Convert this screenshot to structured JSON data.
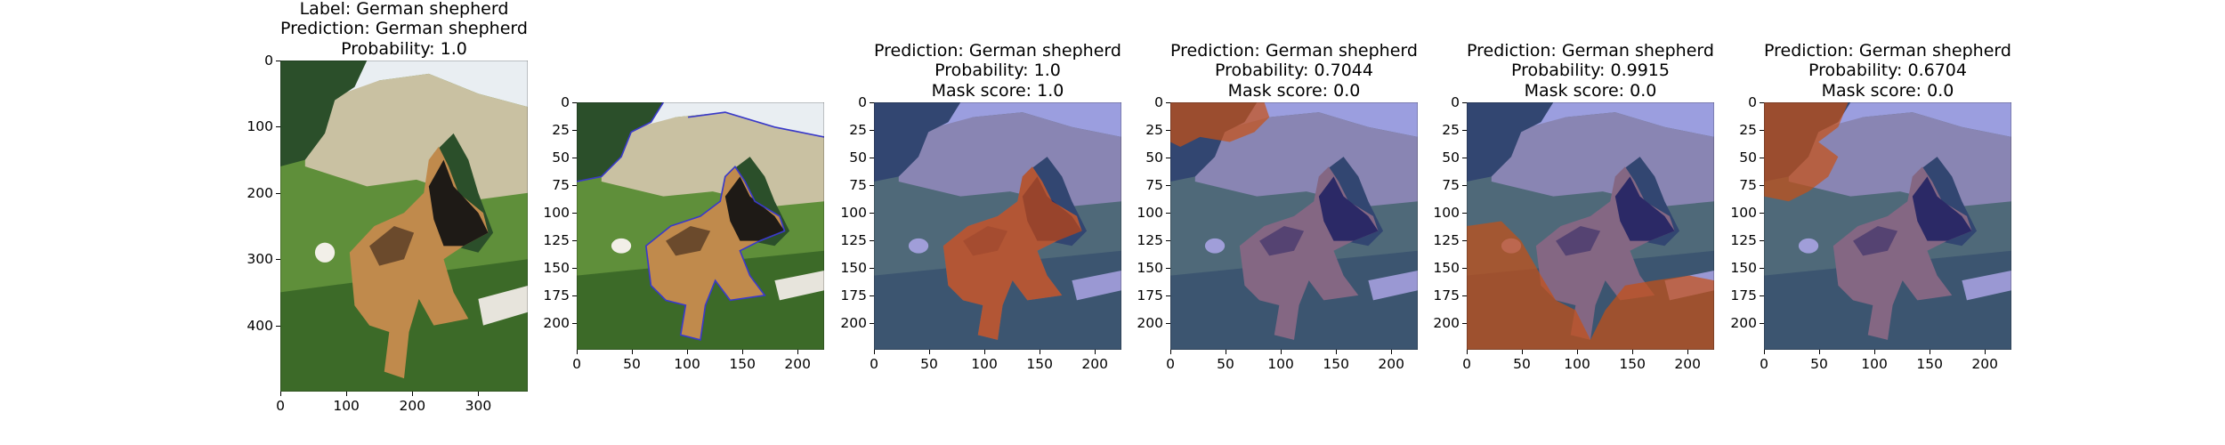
{
  "panels": [
    {
      "id": "original",
      "title_lines": [
        "Label: German shepherd",
        "Prediction: German shepherd",
        "Probability: 1.0"
      ],
      "xticks": [
        "0",
        "100",
        "200",
        "300"
      ],
      "xtick_values": [
        0,
        100,
        200,
        300
      ],
      "yticks": [
        "0",
        "100",
        "200",
        "300",
        "400"
      ],
      "ytick_values": [
        0,
        100,
        200,
        300,
        400
      ],
      "xlim": [
        0,
        375
      ],
      "ylim": [
        0,
        500
      ],
      "overlay": "none"
    },
    {
      "id": "contour",
      "title_lines": [],
      "xticks": [
        "0",
        "50",
        "100",
        "150",
        "200"
      ],
      "xtick_values": [
        0,
        50,
        100,
        150,
        200
      ],
      "yticks": [
        "0",
        "25",
        "50",
        "75",
        "100",
        "125",
        "150",
        "175",
        "200"
      ],
      "ytick_values": [
        0,
        25,
        50,
        75,
        100,
        125,
        150,
        175,
        200
      ],
      "xlim": [
        0,
        224
      ],
      "ylim": [
        0,
        224
      ],
      "overlay": "contour"
    },
    {
      "id": "mask-1",
      "title_lines": [
        "Prediction: German shepherd",
        "Probability: 1.0",
        "Mask score: 1.0"
      ],
      "xticks": [
        "0",
        "50",
        "100",
        "150",
        "200"
      ],
      "xtick_values": [
        0,
        50,
        100,
        150,
        200
      ],
      "yticks": [
        "0",
        "25",
        "50",
        "75",
        "100",
        "125",
        "150",
        "175",
        "200"
      ],
      "ytick_values": [
        0,
        25,
        50,
        75,
        100,
        125,
        150,
        175,
        200
      ],
      "xlim": [
        0,
        224
      ],
      "ylim": [
        0,
        224
      ],
      "overlay": "dog"
    },
    {
      "id": "mask-2",
      "title_lines": [
        "Prediction: German shepherd",
        "Probability: 0.7044",
        "Mask score: 0.0"
      ],
      "xticks": [
        "0",
        "50",
        "100",
        "150",
        "200"
      ],
      "xtick_values": [
        0,
        50,
        100,
        150,
        200
      ],
      "yticks": [
        "0",
        "25",
        "50",
        "75",
        "100",
        "125",
        "150",
        "175",
        "200"
      ],
      "ytick_values": [
        0,
        25,
        50,
        75,
        100,
        125,
        150,
        175,
        200
      ],
      "xlim": [
        0,
        224
      ],
      "ylim": [
        0,
        224
      ],
      "overlay": "tree-top"
    },
    {
      "id": "mask-3",
      "title_lines": [
        "Prediction: German shepherd",
        "Probability: 0.9915",
        "Mask score: 0.0"
      ],
      "xticks": [
        "0",
        "50",
        "100",
        "150",
        "200"
      ],
      "xtick_values": [
        0,
        50,
        100,
        150,
        200
      ],
      "yticks": [
        "0",
        "25",
        "50",
        "75",
        "100",
        "125",
        "150",
        "175",
        "200"
      ],
      "ytick_values": [
        0,
        25,
        50,
        75,
        100,
        125,
        150,
        175,
        200
      ],
      "xlim": [
        0,
        224
      ],
      "ylim": [
        0,
        224
      ],
      "overlay": "grass"
    },
    {
      "id": "mask-4",
      "title_lines": [
        "Prediction: German shepherd",
        "Probability: 0.6704",
        "Mask score: 0.0"
      ],
      "xticks": [
        "0",
        "50",
        "100",
        "150",
        "200"
      ],
      "xtick_values": [
        0,
        50,
        100,
        150,
        200
      ],
      "yticks": [
        "0",
        "25",
        "50",
        "75",
        "100",
        "125",
        "150",
        "175",
        "200"
      ],
      "ytick_values": [
        0,
        25,
        50,
        75,
        100,
        125,
        150,
        175,
        200
      ],
      "xlim": [
        0,
        224
      ],
      "ylim": [
        0,
        224
      ],
      "overlay": "tree-left"
    }
  ],
  "colors": {
    "sky": "#e9eef2",
    "mountain": "#c9c1a2",
    "grass": "#5f8f3a",
    "grass_dark": "#3c6a28",
    "tree": "#2b4f2a",
    "dog_tan": "#c08a4c",
    "dog_black": "#1e1a16",
    "blue_tint": "#3c3cc8",
    "orange_highlight": "#c85014",
    "contour": "#3a3ac8"
  }
}
